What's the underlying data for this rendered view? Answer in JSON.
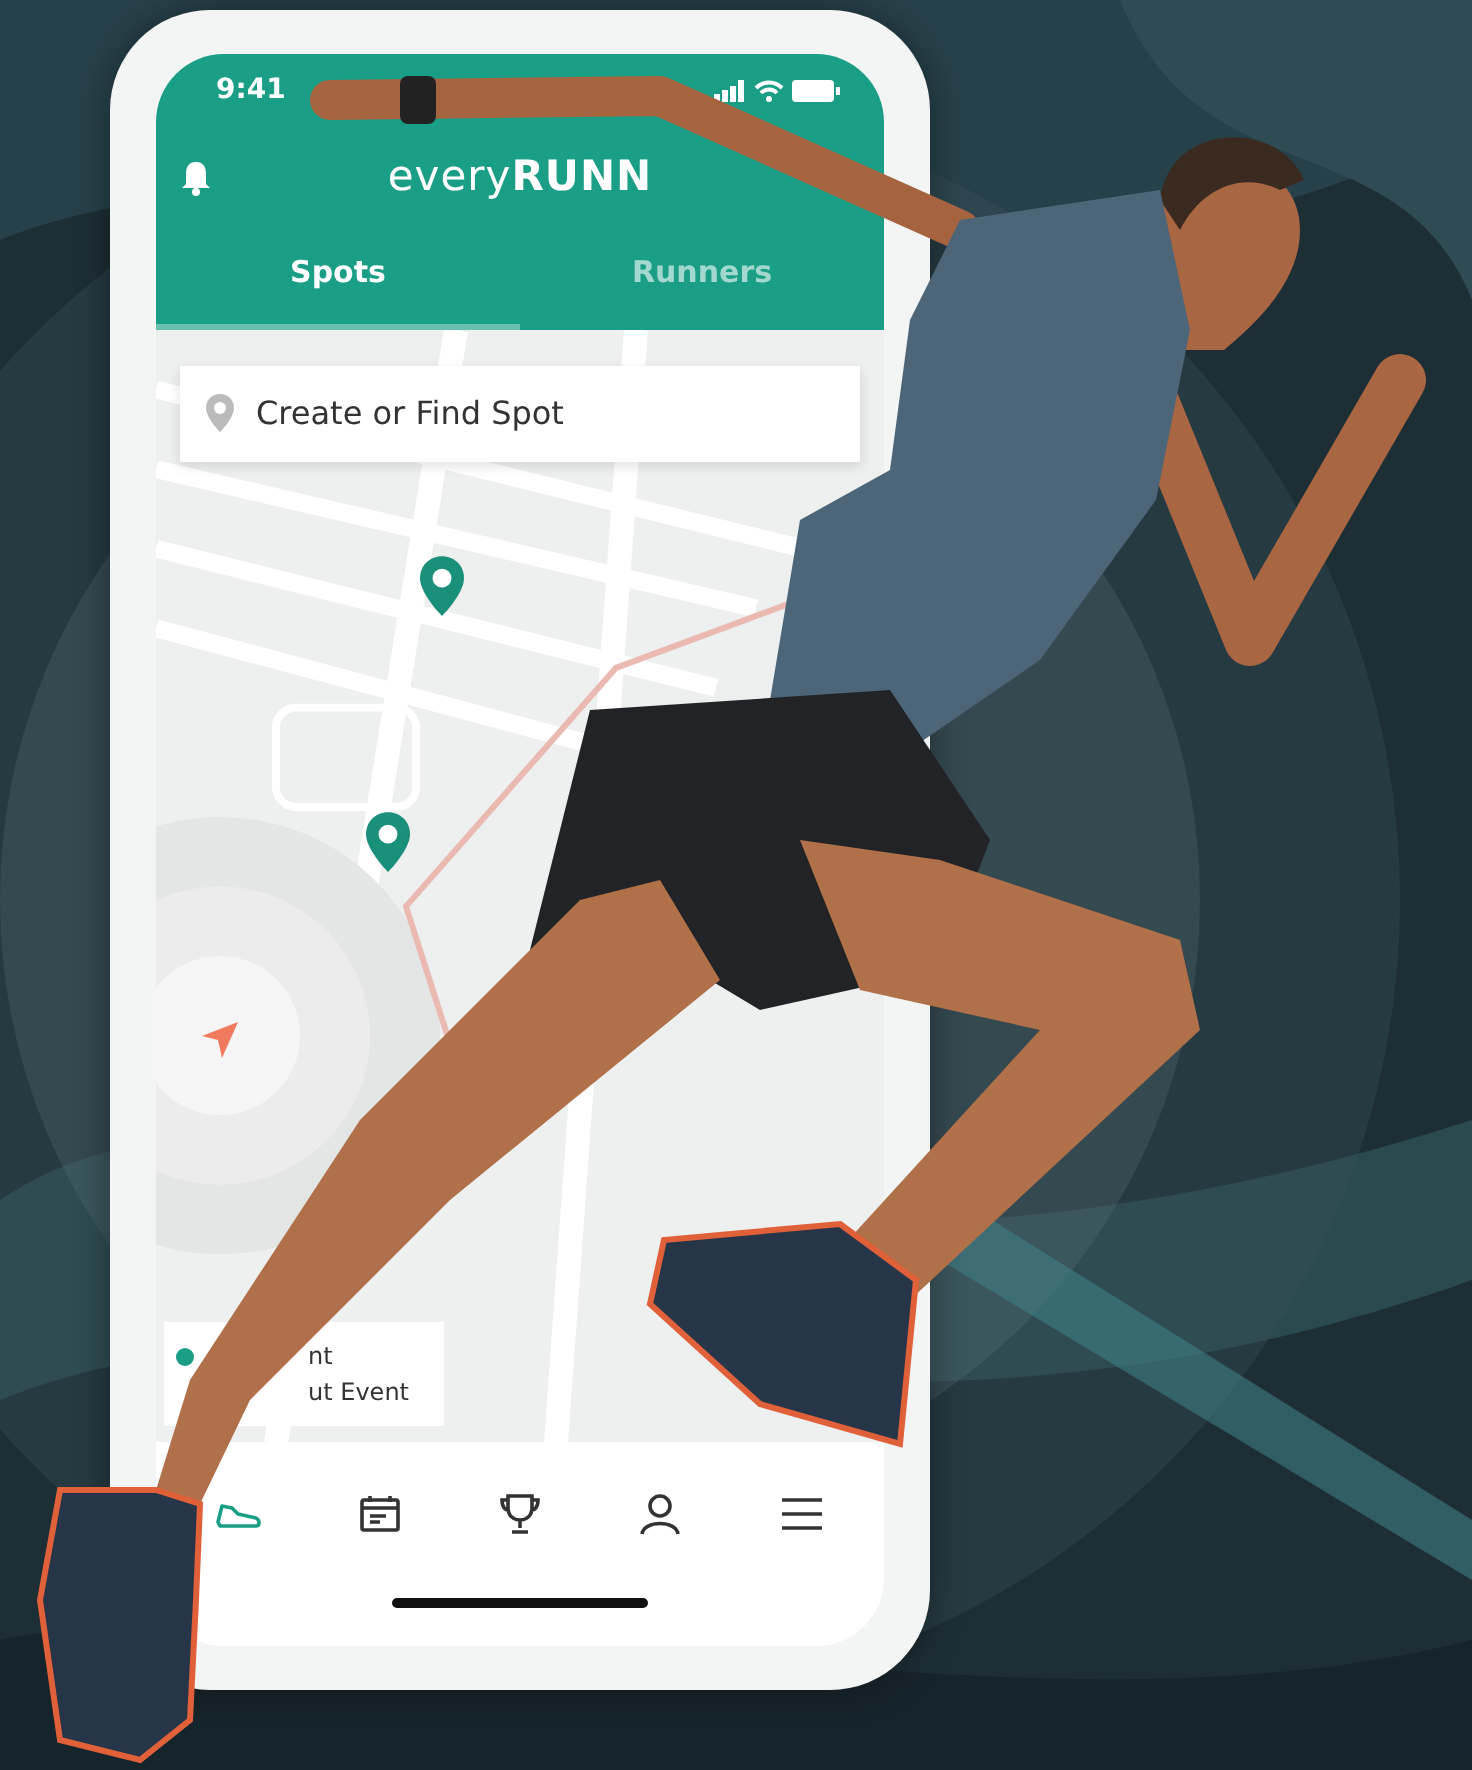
{
  "status_bar": {
    "time": "9:41"
  },
  "header": {
    "brand": "every**RUNN**"
  },
  "tabs": [
    {
      "label": "Spots",
      "selected": true
    },
    {
      "label": "Runners",
      "selected": false
    }
  ],
  "search": {
    "placeholder": "Create or Find Spot"
  },
  "legend": [
    {
      "label": "nt",
      "color": "#1a9e85"
    },
    {
      "label": "ut Event"
    }
  ],
  "bottom_nav": [
    {
      "kind": "run",
      "selected": true
    },
    {
      "kind": "calendar",
      "selected": false
    },
    {
      "kind": "trophy",
      "selected": false
    },
    {
      "kind": "profile",
      "selected": false
    },
    {
      "kind": "menu",
      "selected": false
    }
  ]
}
